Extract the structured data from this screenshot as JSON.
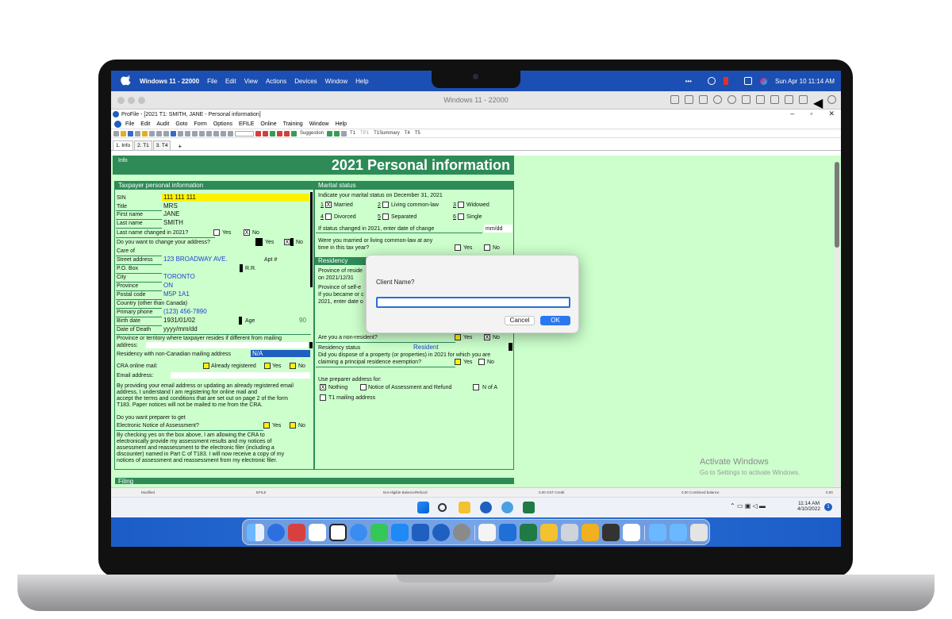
{
  "mac_menubar": {
    "app_name": "Windows 11 - 22000",
    "menus": [
      "File",
      "Edit",
      "View",
      "Actions",
      "Devices",
      "Window",
      "Help"
    ],
    "clock": "Sun Apr 10  11:14 AM"
  },
  "vm_window": {
    "title": "Windows 11 - 22000"
  },
  "app": {
    "title": "ProFile - [2021 T1: SMITH, JANE - Personal information]",
    "menus": [
      "File",
      "Edit",
      "Audit",
      "Goto",
      "Form",
      "Options",
      "EFILE",
      "Online",
      "Training",
      "Window",
      "Help"
    ],
    "toolbar_labels": [
      "Suggestion",
      "T1",
      "TP1",
      "T1Summary",
      "T4",
      "T5"
    ],
    "tabs": [
      "1. Info",
      "2. T1",
      "3. T4"
    ]
  },
  "form": {
    "info_label": "Info",
    "title": "2021 Personal information",
    "taxpayer": {
      "heading": "Taxpayer personal information",
      "sin_label": "SIN",
      "sin": "111 111 111",
      "title_label": "Title",
      "title": "MRS",
      "first_name_label": "First name",
      "first_name": "JANE",
      "last_name_label": "Last name",
      "last_name": "SMITH",
      "last_name_changed_q": "Last name changed in 2021?",
      "yes": "Yes",
      "no": "No",
      "change_address_q": "Do you want to change your address?",
      "care_of_label": "Care of",
      "street_label": "Street address",
      "street": "123 BROADWAY AVE.",
      "apt_label": "Apt #",
      "po_box_label": "P.O. Box",
      "rr_label": "R.R.",
      "city_label": "City",
      "city": "TORONTO",
      "province_label": "Province",
      "province": "ON",
      "postal_label": "Postal code",
      "postal": "M5P 1A1",
      "country_label": "Country (other than Canada)",
      "phone_label": "Primary phone",
      "phone": "(123) 456-7890",
      "birth_label": "Birth date",
      "birth": "1931/01/02",
      "age_label": "Age",
      "age": "90",
      "death_label": "Date of Death",
      "death_placeholder": "yyyy/mm/dd",
      "prov_territory_q": "Province or territory where taxpayer resides if different from mailing",
      "address_label": "address:",
      "non_canadian_label": "Residency with non-Canadian mailing address",
      "non_canadian": "N/A",
      "cra_online_label": "CRA online mail:",
      "already_registered": "Already registered",
      "email_label": "Email address:",
      "email_consent": [
        "By providing your email address or updating an already registered email",
        "address, I understand I am registering for online mail and",
        "accept the terms and conditions that are set out on page 2 of the form",
        "T183. Paper notices will not be mailed to me from the CRA."
      ],
      "preparer_q1": "Do you want preparer to get",
      "preparer_q2": "Electronic Notice of Assessment?",
      "preparer_consent": [
        "By checking yes on the box above, I am allowing the CRA to",
        "electronically provide my assessment results and my notices of",
        "assessment and reassessment to the electronic filer (including a",
        "discounter) named in Part C of T183. I will now receive a copy of my",
        "notices of assessment and reassessment from my electronic filer."
      ]
    },
    "marital": {
      "heading": "Marital status",
      "indicate": "Indicate your marital status on December 31, 2021",
      "options": [
        {
          "num": "1",
          "label": "Married",
          "checked": true
        },
        {
          "num": "2",
          "label": "Living common-law",
          "checked": false
        },
        {
          "num": "3",
          "label": "Widowed",
          "checked": false
        },
        {
          "num": "4",
          "label": "Divorced",
          "checked": false
        },
        {
          "num": "5",
          "label": "Separated",
          "checked": false
        },
        {
          "num": "6",
          "label": "Single",
          "checked": false
        }
      ],
      "status_changed": "If status changed in 2021, enter date of change",
      "date_placeholder": "mm/dd",
      "married_q1": "Were you married or living common-law at any",
      "married_q2": "time in this tax year?"
    },
    "residency": {
      "heading": "Residency",
      "prov_res_1": "Province of reside",
      "prov_res_2": "on 2021/12/31",
      "prov_self": "Province of self-e",
      "became_1": "If you became or c",
      "became_2": "2021, enter date o",
      "non_resident_q": "Are you a non-resident?",
      "residency_status_label": "Residency status",
      "residency_status": "Resident",
      "dispose_q1": "Did you dispose of a property (or properties) in 2021 for which you are",
      "dispose_q2": "claiming a principal residence exemption?",
      "use_preparer": "Use preparer address for:",
      "nothing": "Nothing",
      "noa": "Notice of Assessment and Refund",
      "nof": "N of A",
      "t1_mailing": "T1 mailing address"
    },
    "filing_heading": "Filing"
  },
  "dialog": {
    "question": "Client Name?",
    "input_value": "",
    "cancel": "Cancel",
    "ok": "OK"
  },
  "statusbar": [
    "Modified",
    "EFILE",
    "Not eligible  Balance/Refund",
    "0.00  GST Credit",
    "0.00  Combined balance",
    "0.00"
  ],
  "watermark": {
    "line1": "Activate Windows",
    "line2": "Go to Settings to activate Windows."
  },
  "taskbar": {
    "time": "11:14 AM",
    "date": "4/10/2022",
    "notifications": "1"
  }
}
